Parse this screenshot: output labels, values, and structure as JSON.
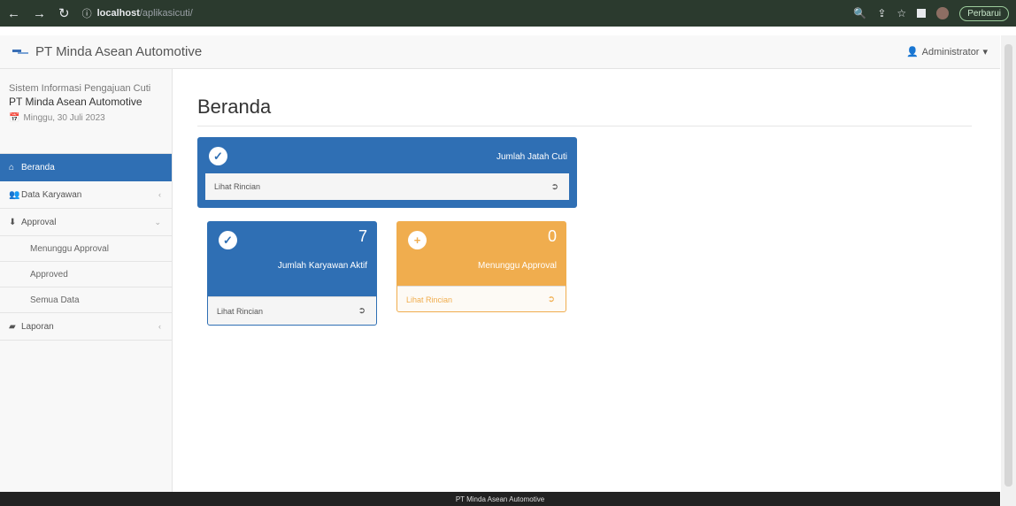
{
  "browser": {
    "url_host": "localhost",
    "url_path": "/aplikasicuti/",
    "paused_label": "Perbarui"
  },
  "topbar": {
    "brand": "PT Minda Asean Automotive",
    "user": "Administrator"
  },
  "sidebar": {
    "system_name": "Sistem Informasi Pengajuan Cuti",
    "company": "PT Minda Asean Automotive",
    "date": "Minggu, 30 Juli 2023",
    "items": [
      {
        "label": "Beranda",
        "icon": "home-icon"
      },
      {
        "label": "Data Karyawan",
        "icon": "users-icon"
      },
      {
        "label": "Approval",
        "icon": "approval-icon"
      },
      {
        "label": "Laporan",
        "icon": "folder-icon"
      }
    ],
    "sub_items": [
      {
        "label": "Menunggu Approval"
      },
      {
        "label": "Approved"
      },
      {
        "label": "Semua Data"
      }
    ]
  },
  "main": {
    "title": "Beranda",
    "panels": [
      {
        "label": "Jumlah Jatah Cuti",
        "value": "",
        "link": "Lihat Rincian",
        "color": "#2f6fb4"
      },
      {
        "label": "Jumlah Karyawan Aktif",
        "value": "7",
        "link": "Lihat Rincian",
        "color": "#2f6fb4"
      },
      {
        "label": "Menunggu Approval",
        "value": "0",
        "link": "Lihat Rincian",
        "color": "#f0ad4e"
      }
    ]
  },
  "footer": {
    "text": "PT Minda Asean Automotive"
  }
}
